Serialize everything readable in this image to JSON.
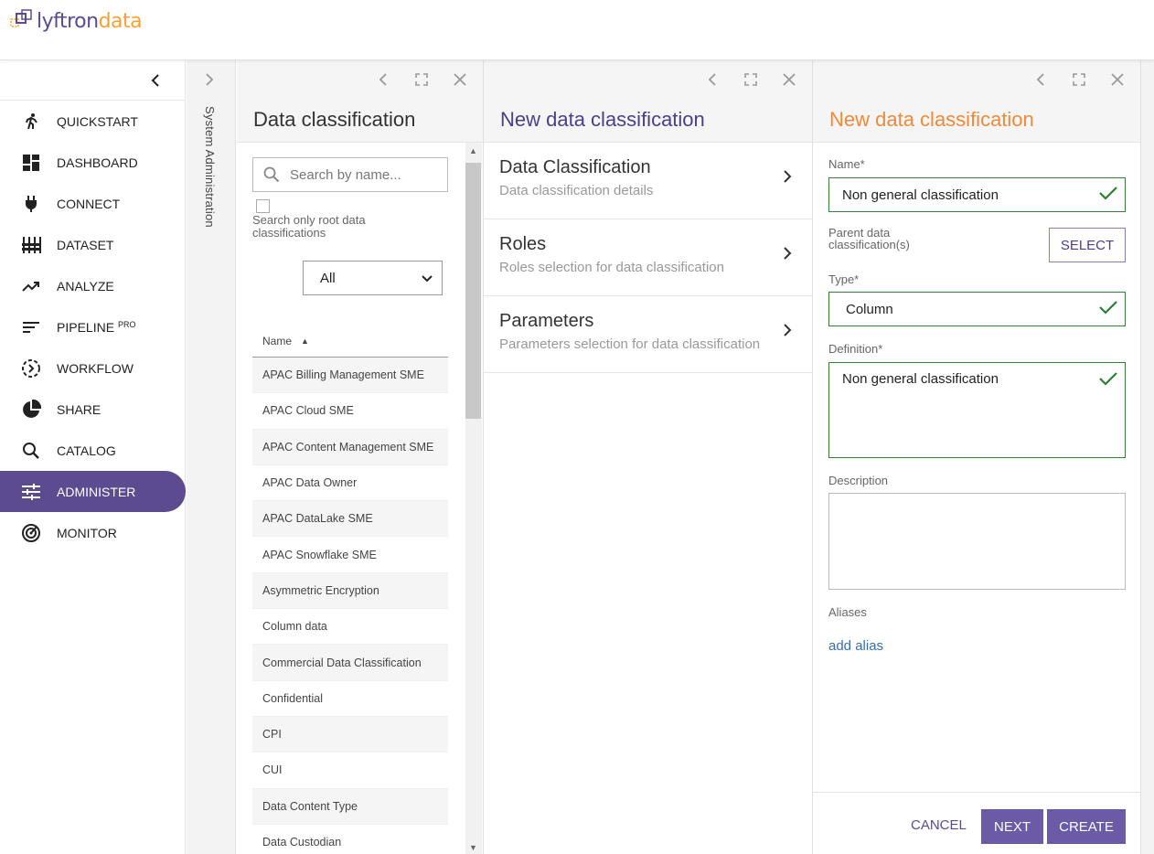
{
  "brand": {
    "part1": "lyftron",
    "part2": "data"
  },
  "sidebar": {
    "items": [
      {
        "label": "QUICKSTART",
        "icon": "run-icon"
      },
      {
        "label": "DASHBOARD",
        "icon": "dashboard-icon"
      },
      {
        "label": "CONNECT",
        "icon": "plug-icon"
      },
      {
        "label": "DATASET",
        "icon": "dataset-icon"
      },
      {
        "label": "ANALYZE",
        "icon": "trending-icon"
      },
      {
        "label": "PIPELINE",
        "icon": "pipeline-icon",
        "sup": "PRO"
      },
      {
        "label": "WORKFLOW",
        "icon": "workflow-icon"
      },
      {
        "label": "SHARE",
        "icon": "pie-icon"
      },
      {
        "label": "CATALOG",
        "icon": "search-icon"
      },
      {
        "label": "ADMINISTER",
        "icon": "sliders-icon",
        "active": true
      },
      {
        "label": "MONITOR",
        "icon": "target-icon"
      }
    ]
  },
  "collapsed_panel": {
    "label": "System Administration"
  },
  "panel1": {
    "title": "Data classification",
    "search_placeholder": "Search by name...",
    "root_only_label": "Search only root data classifications",
    "filter_value": "All",
    "column_header": "Name",
    "rows": [
      "APAC Billing Management SME",
      "APAC Cloud SME",
      "APAC Content Management SME",
      "APAC Data Owner",
      "APAC DataLake SME",
      "APAC Snowflake SME",
      "Asymmetric Encryption",
      "Column data",
      "Commercial Data Classification",
      "Confidential",
      "CPI",
      "CUI",
      "Data Content Type",
      "Data Custodian"
    ]
  },
  "panel2": {
    "title": "New data classification",
    "steps": [
      {
        "title": "Data Classification",
        "subtitle": "Data classification details"
      },
      {
        "title": "Roles",
        "subtitle": "Roles selection for data classification"
      },
      {
        "title": "Parameters",
        "subtitle": "Parameters selection for data classification"
      }
    ]
  },
  "panel3": {
    "title": "New data classification",
    "name_label": "Name*",
    "name_value": "Non general classification",
    "parent_label": "Parent data classification(s)",
    "select_label": "SELECT",
    "type_label": "Type*",
    "type_value": "Column",
    "definition_label": "Definition*",
    "definition_value": "Non general classification",
    "description_label": "Description",
    "aliases_label": "Aliases",
    "add_alias_label": "add alias",
    "cancel_label": "CANCEL",
    "next_label": "NEXT",
    "create_label": "CREATE"
  },
  "colors": {
    "brand_purple": "#5c4b8e",
    "brand_orange": "#f2a33a",
    "valid_green": "#2e7d32"
  }
}
